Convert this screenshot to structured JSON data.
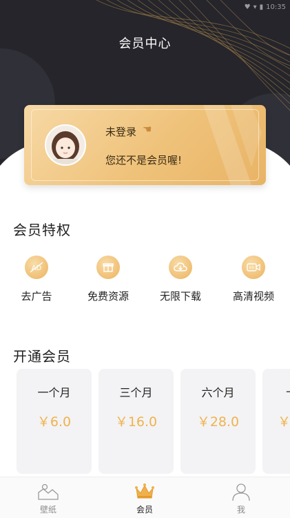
{
  "status_bar": {
    "time": "10:35"
  },
  "header": {
    "title": "会员中心"
  },
  "card": {
    "login_text": "未登录",
    "subtext": "您还不是会员喔!"
  },
  "perks": {
    "title": "会员特权",
    "items": [
      {
        "label": "去广告",
        "icon": "no-ads-icon"
      },
      {
        "label": "免费资源",
        "icon": "gift-icon"
      },
      {
        "label": "无限下载",
        "icon": "cloud-download-icon"
      },
      {
        "label": "高清视频",
        "icon": "hd-video-icon"
      }
    ]
  },
  "plans": {
    "title": "开通会员",
    "items": [
      {
        "name": "一个月",
        "price": "￥6.0"
      },
      {
        "name": "三个月",
        "price": "￥16.0"
      },
      {
        "name": "六个月",
        "price": "￥28.0"
      },
      {
        "name": "十",
        "price": "￥"
      }
    ]
  },
  "bottom_nav": {
    "items": [
      {
        "label": "壁纸",
        "icon": "wallpaper-icon"
      },
      {
        "label": "会员",
        "icon": "crown-icon"
      },
      {
        "label": "我",
        "icon": "user-icon"
      }
    ],
    "active_index": 1
  },
  "colors": {
    "header_bg": "#25252b",
    "gold_accent": "#efb34e",
    "card_gold": "#efc27a"
  }
}
